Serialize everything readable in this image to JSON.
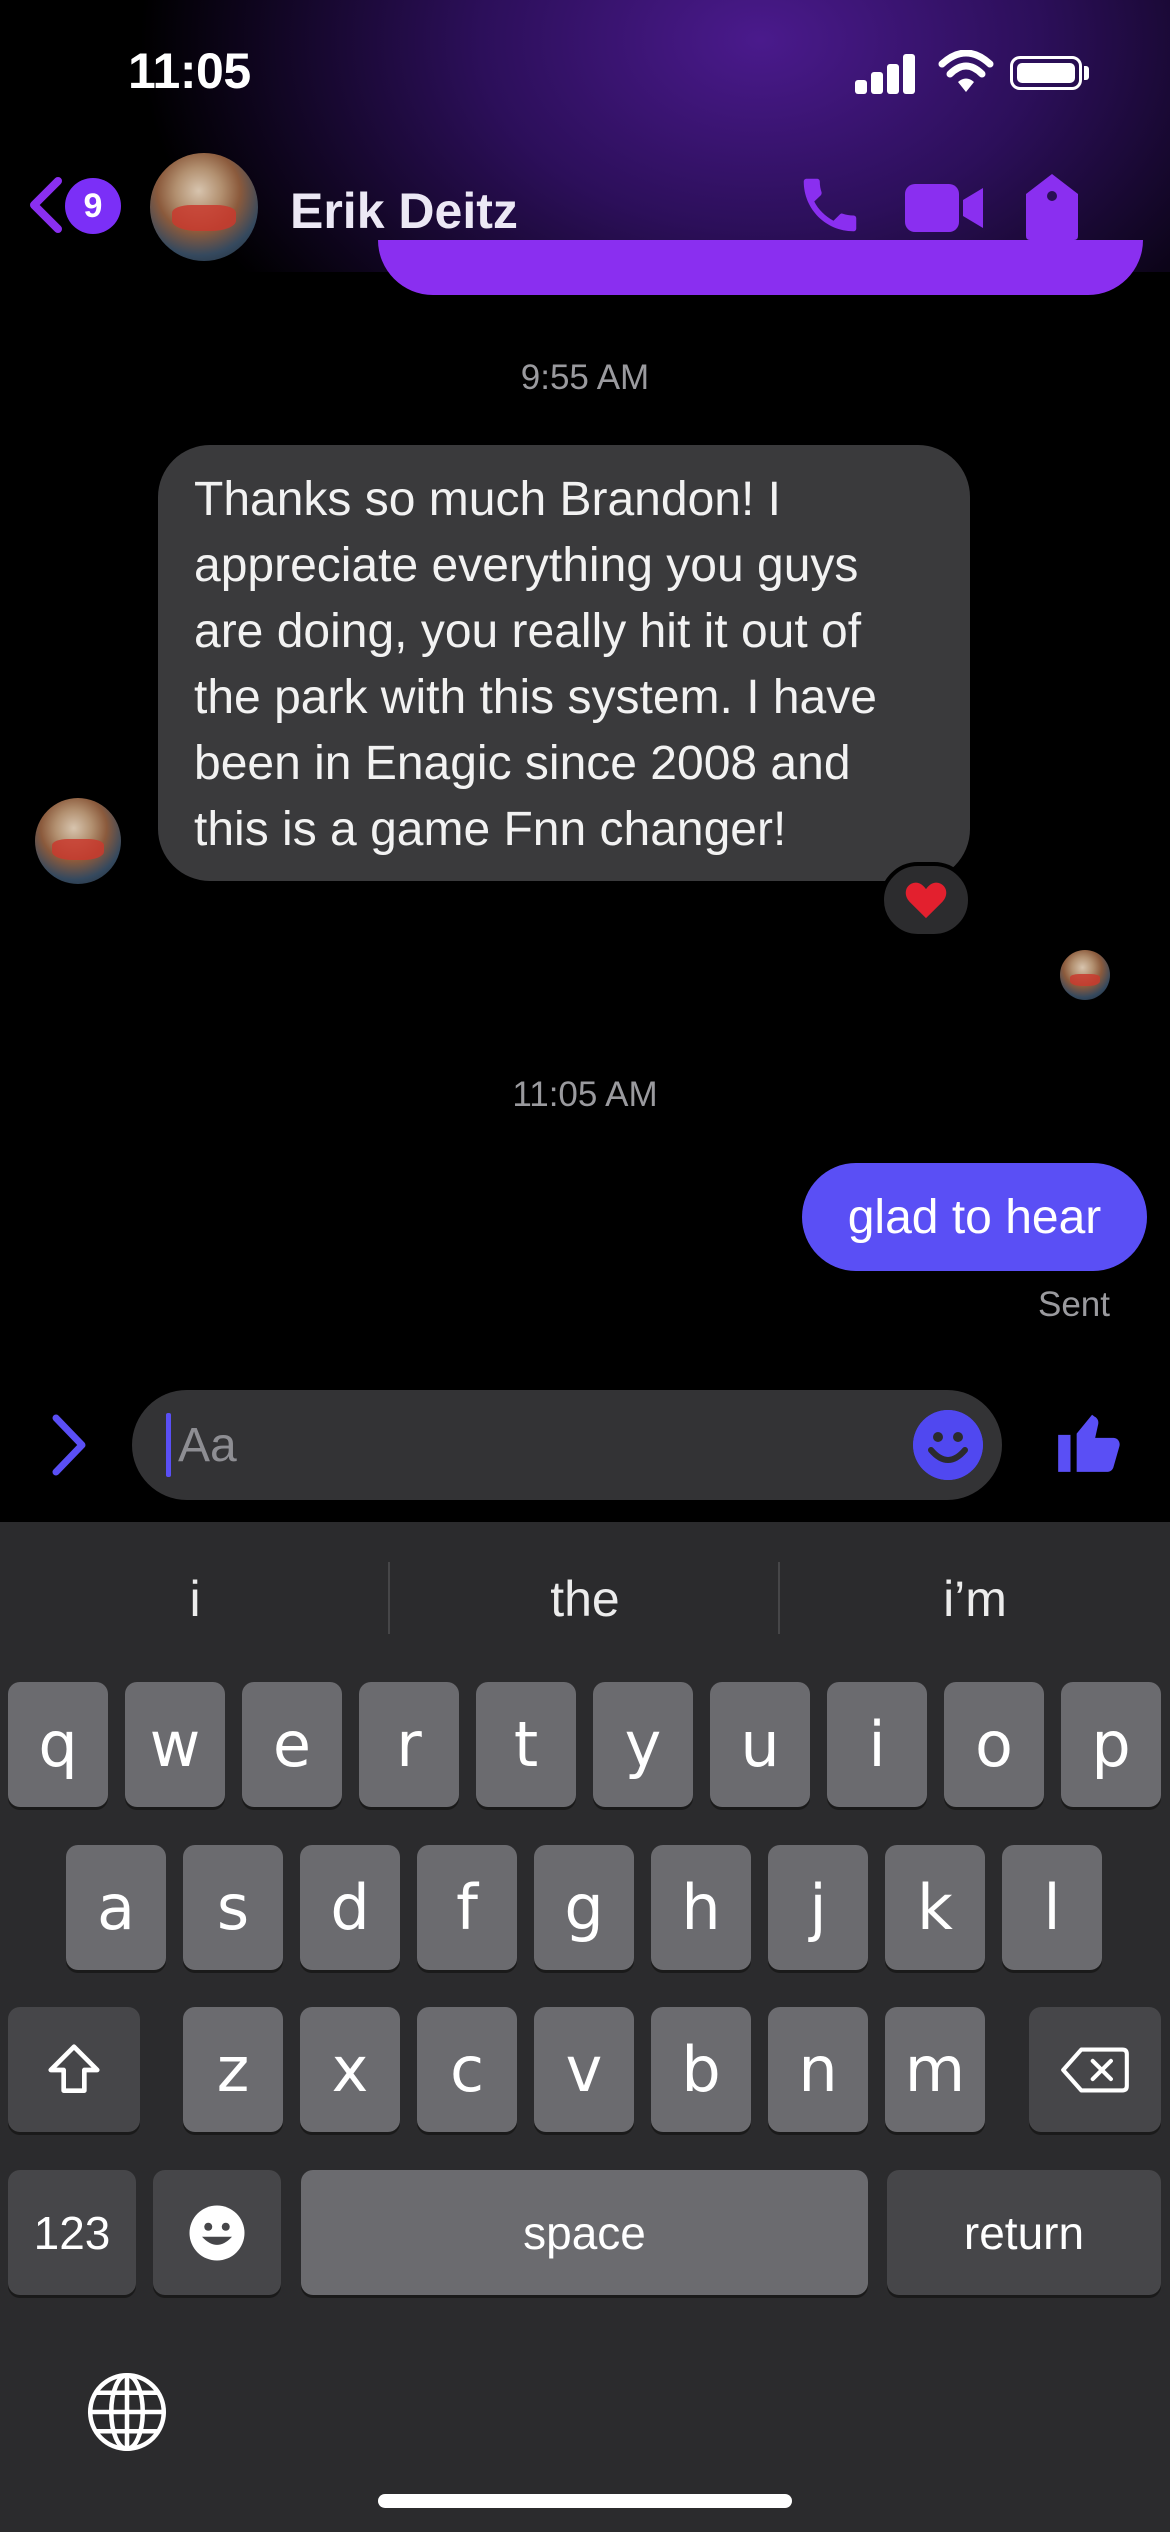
{
  "status_bar": {
    "time": "11:05"
  },
  "header": {
    "back_badge_count": "9",
    "contact_name": "Erik Deitz",
    "icons": [
      "back-chevron-icon",
      "phone-icon",
      "video-camera-icon",
      "tag-icon"
    ]
  },
  "messages": {
    "timestamp_1": "9:55 AM",
    "incoming_text": "Thanks so much Brandon! I\nappreciate everything you guys\nare doing, you really hit it out of\nthe park with this system. I have\nbeen in Enagic since 2008 and\nthis is a game Fnn changer!",
    "reaction": "❤️",
    "timestamp_2": "11:05 AM",
    "outgoing_text": "glad to hear",
    "delivery_status": "Sent"
  },
  "composer": {
    "placeholder": "Aa"
  },
  "keyboard": {
    "suggestions": [
      "i",
      "the",
      "i’m"
    ],
    "row1": [
      "q",
      "w",
      "e",
      "r",
      "t",
      "y",
      "u",
      "i",
      "o",
      "p"
    ],
    "row2": [
      "a",
      "s",
      "d",
      "f",
      "g",
      "h",
      "j",
      "k",
      "l"
    ],
    "row3": [
      "z",
      "x",
      "c",
      "v",
      "b",
      "n",
      "m"
    ],
    "numbers_label": "123",
    "space_label": "space",
    "return_label": "return"
  },
  "colors": {
    "accent_purple": "#8a2ff0",
    "outgoing_bubble": "#5a4ff5",
    "incoming_bubble": "#3a3a3c",
    "keyboard_bg": "#2b2b2d"
  }
}
